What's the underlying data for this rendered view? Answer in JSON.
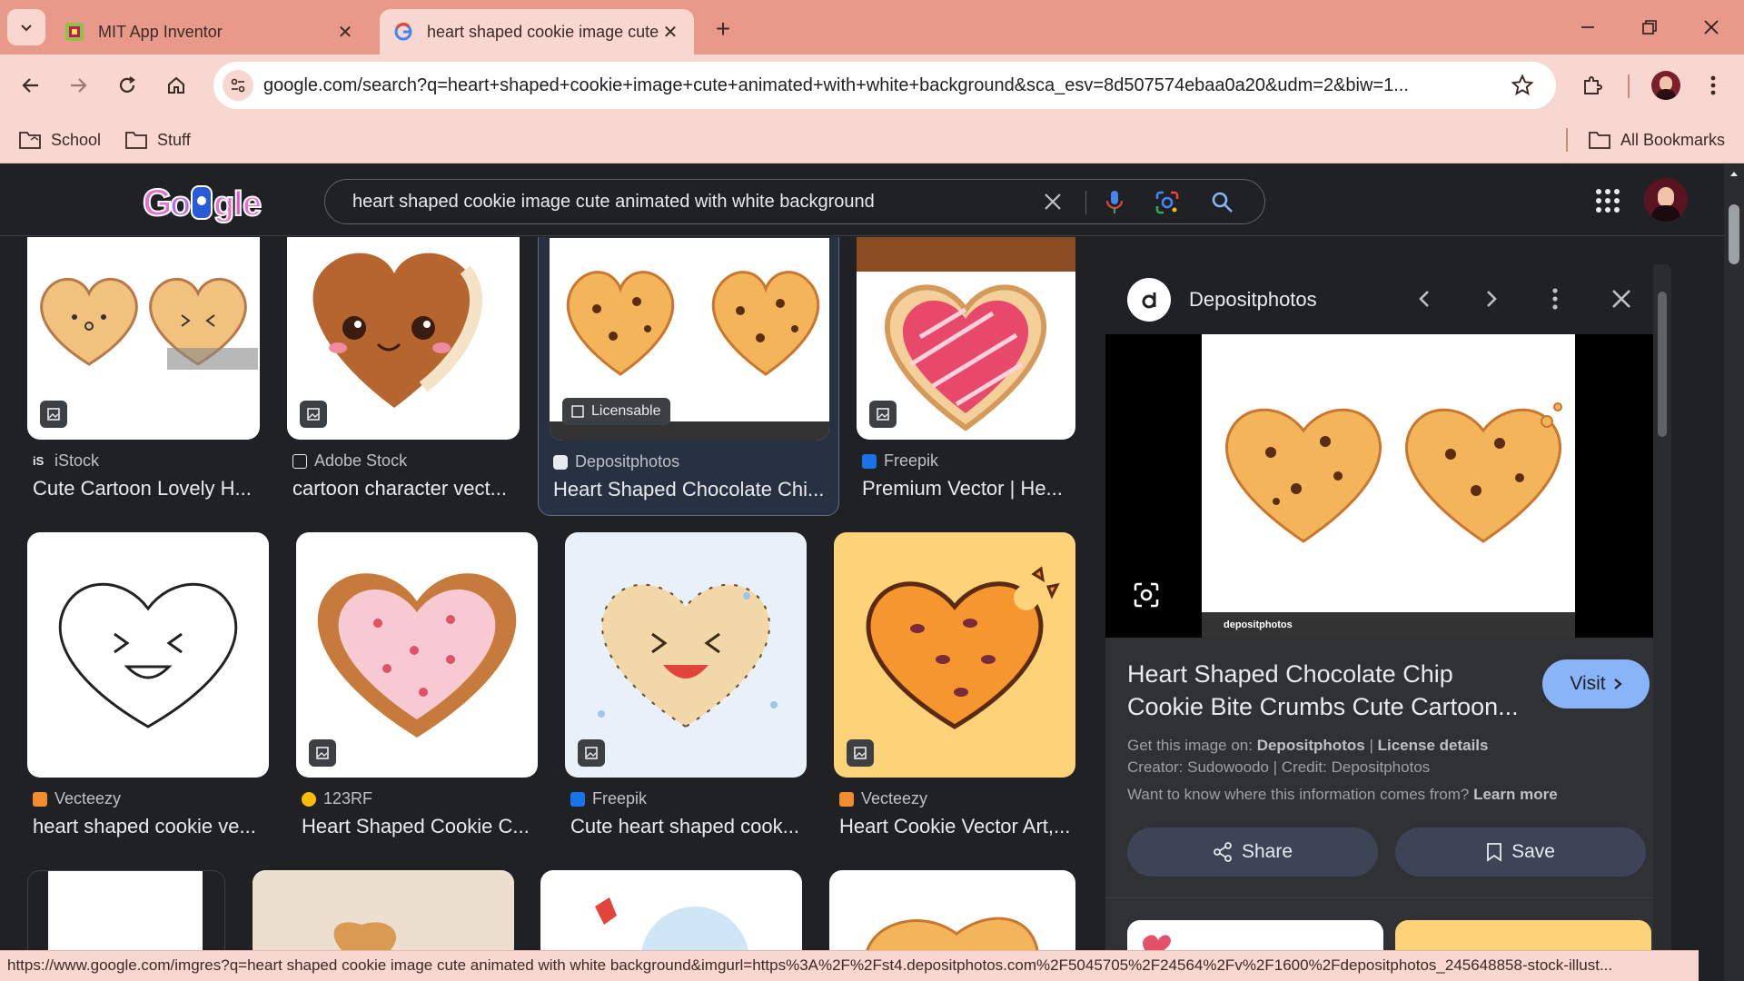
{
  "browser": {
    "tabs": [
      {
        "title": "MIT App Inventor",
        "active": false
      },
      {
        "title": "heart shaped cookie image cute",
        "active": true
      }
    ],
    "new_tab": "+",
    "url": "google.com/search?q=heart+shaped+cookie+image+cute+animated+with+white+background&sca_esv=8d507574ebaa0a20&udm=2&biw=1...",
    "bookmarks": [
      {
        "label": "School"
      },
      {
        "label": "Stuff"
      }
    ],
    "all_bookmarks": "All Bookmarks",
    "status_url": "https://www.google.com/imgres?q=heart shaped cookie image cute animated with white background&imgurl=https%3A%2F%2Fst4.depositphotos.com%2F5045705%2F24564%2Fv%2F1600%2Fdepositphotos_245648858-stock-illust..."
  },
  "search": {
    "query": "heart shaped cookie image cute animated with white background"
  },
  "results": [
    {
      "source": "iStock",
      "title": "Cute Cartoon Lovely H...",
      "source_color": "#e8eaed"
    },
    {
      "source": "Adobe Stock",
      "title": "cartoon character vect...",
      "source_color": "#e8eaed"
    },
    {
      "source": "Depositphotos",
      "title": "Heart Shaped Chocolate Chi...",
      "badge": "Licensable",
      "source_color": "#e8eaed"
    },
    {
      "source": "Freepik",
      "title": "Premium Vector | He...",
      "source_color": "#1a73e8"
    },
    {
      "source": "Vecteezy",
      "title": "heart shaped cookie ve...",
      "source_color": "#f28b2c"
    },
    {
      "source": "123RF",
      "title": "Heart Shaped Cookie C...",
      "source_color": "#fbbc04"
    },
    {
      "source": "Freepik",
      "title": "Cute heart shaped cook...",
      "source_color": "#1a73e8"
    },
    {
      "source": "Vecteezy",
      "title": "Heart Cookie Vector Art,...",
      "source_color": "#f28b2c"
    }
  ],
  "panel": {
    "source": "Depositphotos",
    "watermark": "depositphotos",
    "title": "Heart Shaped Chocolate Chip Cookie Bite Crumbs Cute Cartoon...",
    "visit": "Visit",
    "get_image_prefix": "Get this image on:",
    "get_image_source": "Depositphotos",
    "separator": "|",
    "license": "License details",
    "credits": "Creator: Sudowoodo | Credit: Depositphotos",
    "info_prefix": "Want to know where this information comes from?",
    "learn_more": "Learn more",
    "share": "Share",
    "save": "Save"
  },
  "colors": {
    "tab_strip": "#e8998a",
    "toolbar": "#f7d7cf",
    "page_bg": "#202124",
    "panel_bg": "#303134",
    "visit_button": "#8ab4f8",
    "action_button": "#3c4455"
  }
}
